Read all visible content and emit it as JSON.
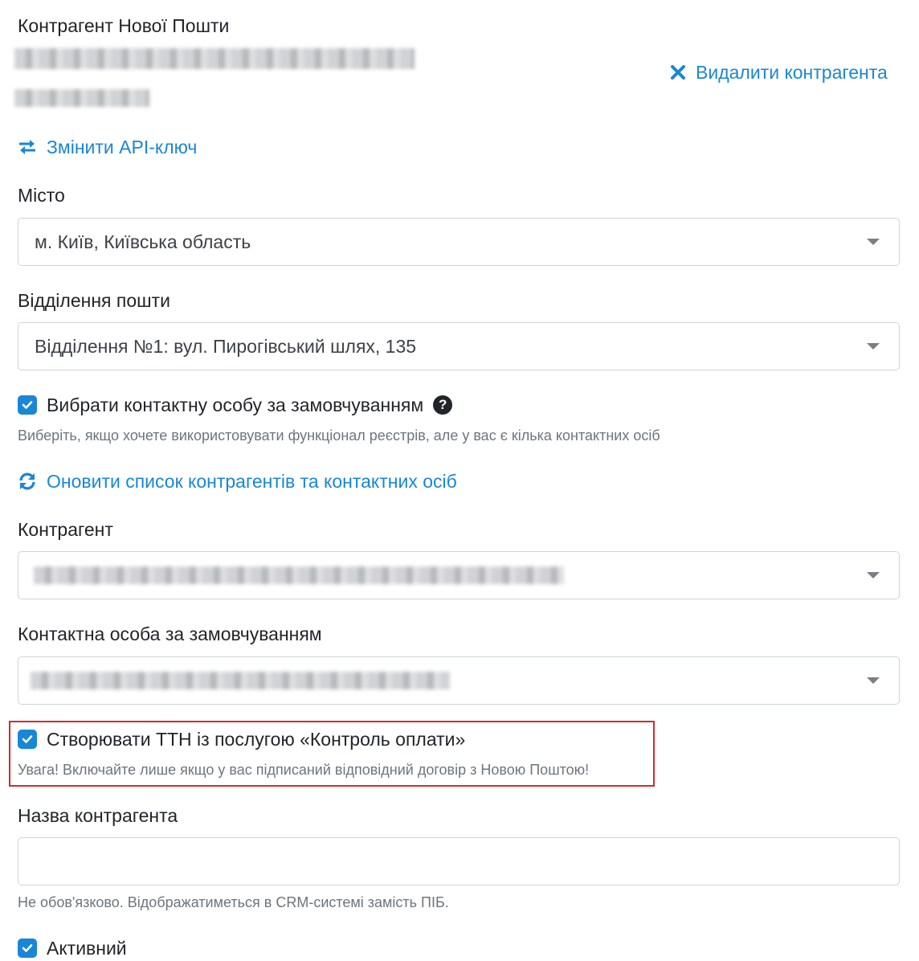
{
  "header": {
    "title": "Контрагент Нової Пошти",
    "delete_label": "Видалити контрагента",
    "change_api_label": "Змінити API-ключ"
  },
  "city": {
    "label": "Місто",
    "value": "м. Київ, Київська область"
  },
  "post_office": {
    "label": "Відділення пошти",
    "value": "Відділення №1: вул. Пирогівський шлях, 135"
  },
  "default_contact_checkbox": {
    "label": "Вибрати контактну особу за замовчуванням",
    "checked": true,
    "help": "Виберіть, якщо хочете використовувати функціонал реєстрів, але у вас є кілька контактних осіб"
  },
  "refresh_label": "Оновити список контрагентів та контактних осіб",
  "counterparty": {
    "label": "Контрагент"
  },
  "default_contact": {
    "label": "Контактна особа за замовчуванням"
  },
  "payment_control_checkbox": {
    "label": "Створювати ТТН із послугою «Контроль оплати»",
    "checked": true,
    "warning": "Увага! Включайте лише якщо у вас підписаний відповідний договір з Новою Поштою!"
  },
  "counterparty_name": {
    "label": "Назва контрагента",
    "value": "",
    "help": "Не обов'язково. Відображатиметься в CRM-системі замість ПІБ."
  },
  "active_checkbox": {
    "label": "Активний",
    "checked": true
  },
  "colors": {
    "accent": "#1a86d6",
    "highlight_border": "#d42a2a",
    "text": "#212529",
    "muted": "#6c757d"
  }
}
